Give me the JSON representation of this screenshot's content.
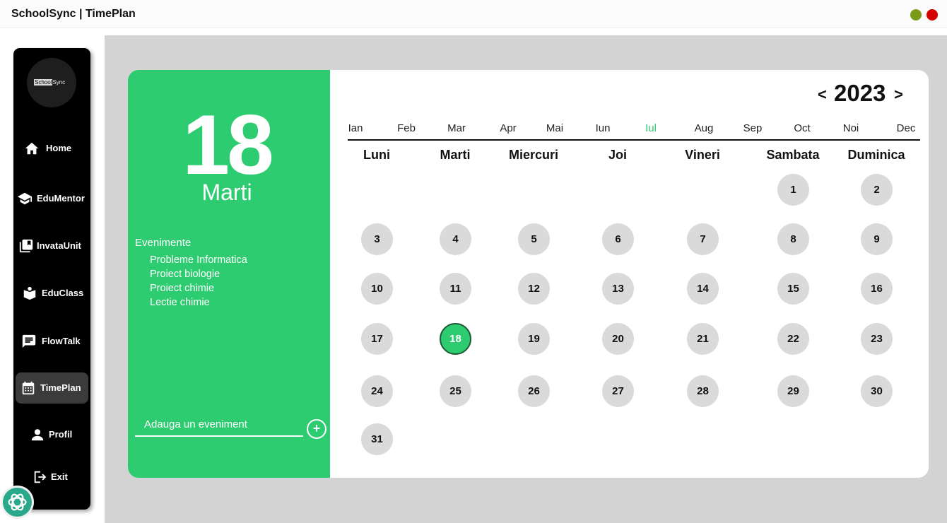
{
  "window": {
    "title": "SchoolSync | TimePlan"
  },
  "logo": {
    "part1": "School",
    "part2": "Sync"
  },
  "sidebar": {
    "items": [
      {
        "label": "Home",
        "icon": "home-icon"
      },
      {
        "label": "EduMentor",
        "icon": "graduation-cap-icon"
      },
      {
        "label": "InvataUnit",
        "icon": "book-icon"
      },
      {
        "label": "EduClass",
        "icon": "reader-icon"
      },
      {
        "label": "FlowTalk",
        "icon": "chat-icon"
      },
      {
        "label": "TimePlan",
        "icon": "calendar-icon",
        "active": true
      },
      {
        "label": "Profil",
        "icon": "user-icon"
      },
      {
        "label": "Exit",
        "icon": "logout-icon"
      }
    ]
  },
  "selected": {
    "day": "18",
    "weekday": "Marti"
  },
  "events": {
    "title": "Evenimente",
    "items": [
      "Probleme Informatica",
      "Proiect biologie",
      "Proiect chimie",
      "Lectie chimie"
    ]
  },
  "add_event": {
    "placeholder": "Adauga un eveniment",
    "button": "+"
  },
  "calendar": {
    "year": "2023",
    "prev": "<",
    "next": ">",
    "months": [
      "Ian",
      "Feb",
      "Mar",
      "Apr",
      "Mai",
      "Iun",
      "Iul",
      "Aug",
      "Sep",
      "Oct",
      "Noi",
      "Dec"
    ],
    "active_month": "Iul",
    "weekdays": [
      "Luni",
      "Marti",
      "Miercuri",
      "Joi",
      "Vineri",
      "Sambata",
      "Duminica"
    ],
    "first_weekday_index": 5,
    "days_in_month": 31,
    "selected_day": 18
  },
  "colors": {
    "accent": "#2ecc71",
    "sidebar": "#000000",
    "background": "#d3d3d3",
    "date_circle": "#dadada"
  },
  "assistant": {
    "icon": "openai-icon"
  }
}
